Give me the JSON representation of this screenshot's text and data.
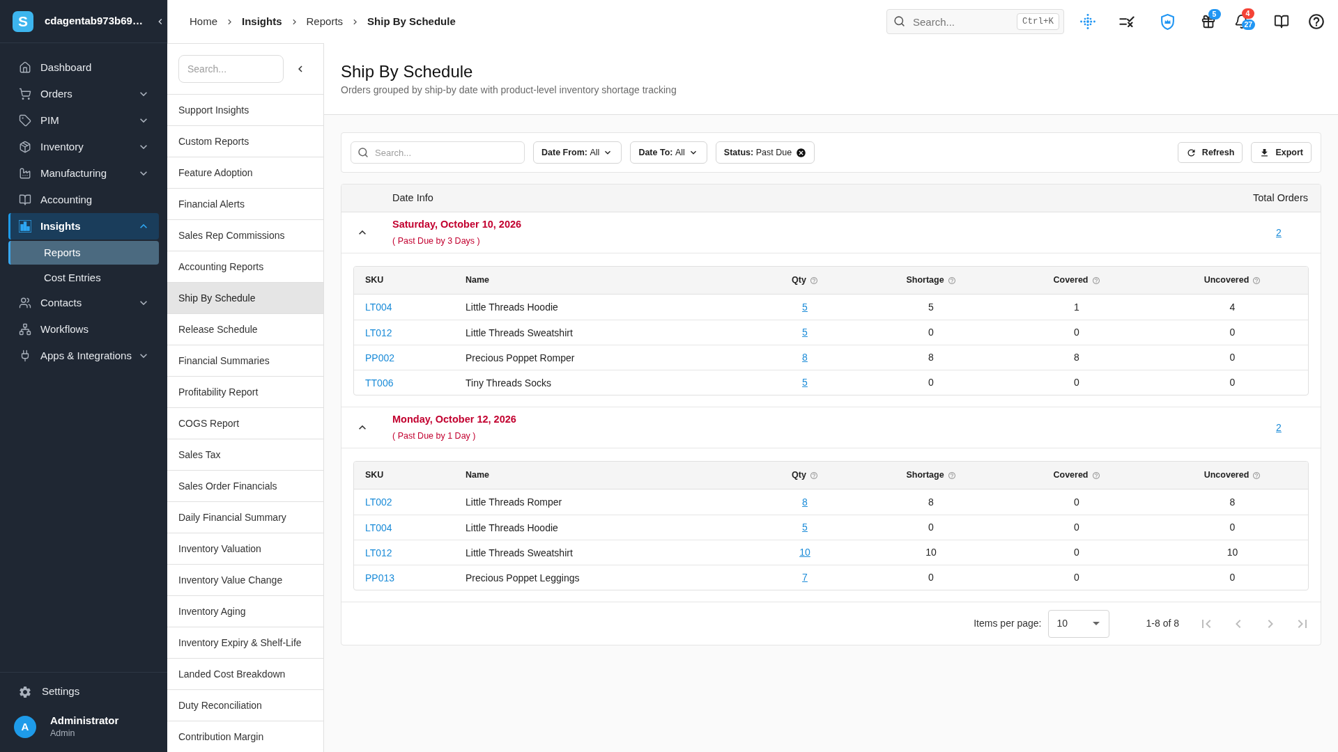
{
  "sidebar": {
    "logo_letter": "S",
    "workspace": "cdagentab973b69…",
    "nav": [
      {
        "label": "Dashboard",
        "kind": "link",
        "selected": false
      },
      {
        "label": "Orders",
        "kind": "group",
        "expanded": false,
        "selected": false
      },
      {
        "label": "PIM",
        "kind": "group",
        "expanded": false,
        "selected": false
      },
      {
        "label": "Inventory",
        "kind": "group",
        "expanded": false,
        "selected": false
      },
      {
        "label": "Manufacturing",
        "kind": "group",
        "expanded": false,
        "selected": false
      },
      {
        "label": "Accounting",
        "kind": "link",
        "selected": false
      },
      {
        "label": "Insights",
        "kind": "group",
        "expanded": true,
        "selected": true,
        "children": [
          {
            "label": "Reports",
            "selected": true
          },
          {
            "label": "Cost Entries",
            "selected": false
          }
        ]
      },
      {
        "label": "Contacts",
        "kind": "group",
        "expanded": false,
        "selected": false
      },
      {
        "label": "Workflows",
        "kind": "link",
        "selected": false
      },
      {
        "label": "Apps & Integrations",
        "kind": "group",
        "expanded": false,
        "selected": false
      }
    ],
    "settings": "Settings",
    "user": {
      "initial": "A",
      "name": "Administrator",
      "role": "Admin"
    }
  },
  "header": {
    "breadcrumb": [
      {
        "label": "Home",
        "strong": false
      },
      {
        "label": "Insights",
        "strong": true
      },
      {
        "label": "Reports",
        "strong": false
      },
      {
        "label": "Ship By Schedule",
        "strong": true
      }
    ],
    "search": {
      "placeholder": "Search...",
      "shortcut": "Ctrl+K"
    },
    "badges": [
      {
        "text": "5",
        "color": "#2196f3"
      },
      {
        "text": "4",
        "color": "#f44336"
      },
      {
        "text": "27",
        "color": "#2196f3"
      }
    ]
  },
  "report_menu": {
    "search": {
      "placeholder": "Search..."
    },
    "items": [
      {
        "label": "Support Insights",
        "selected": false
      },
      {
        "label": "Custom Reports",
        "selected": false
      },
      {
        "label": "Feature Adoption",
        "selected": false
      },
      {
        "label": "Financial Alerts",
        "selected": false
      },
      {
        "label": "Sales Rep Commissions",
        "selected": false
      },
      {
        "label": "Accounting Reports",
        "selected": false
      },
      {
        "label": "Ship By Schedule",
        "selected": true
      },
      {
        "label": "Release Schedule",
        "selected": false
      },
      {
        "label": "Financial Summaries",
        "selected": false
      },
      {
        "label": "Profitability Report",
        "selected": false
      },
      {
        "label": "COGS Report",
        "selected": false
      },
      {
        "label": "Sales Tax",
        "selected": false
      },
      {
        "label": "Sales Order Financials",
        "selected": false
      },
      {
        "label": "Daily Financial Summary",
        "selected": false
      },
      {
        "label": "Inventory Valuation",
        "selected": false
      },
      {
        "label": "Inventory Value Change",
        "selected": false
      },
      {
        "label": "Inventory Aging",
        "selected": false
      },
      {
        "label": "Inventory Expiry & Shelf-Life",
        "selected": false
      },
      {
        "label": "Landed Cost Breakdown",
        "selected": false
      },
      {
        "label": "Duty Reconciliation",
        "selected": false
      },
      {
        "label": "Contribution Margin",
        "selected": false
      }
    ]
  },
  "page": {
    "title": "Ship By Schedule",
    "subtitle": "Orders grouped by ship-by date with product-level inventory shortage tracking"
  },
  "filters": {
    "search": {
      "placeholder": "Search..."
    },
    "chips": [
      {
        "kind": "dropdown",
        "label": "Date From:",
        "value": "All"
      },
      {
        "kind": "dropdown",
        "label": "Date To:",
        "value": "All"
      },
      {
        "kind": "removable",
        "label": "Status:",
        "value": "Past Due"
      }
    ],
    "buttons": [
      {
        "label": "Refresh"
      },
      {
        "label": "Export"
      }
    ]
  },
  "orders_table": {
    "columns": [
      "Date Info",
      "Total Orders"
    ],
    "groups": [
      {
        "date": "Saturday, October 10, 2026",
        "note": "( Past Due by 3 Days )",
        "total": "2",
        "expanded": true,
        "columns": [
          {
            "label": "SKU",
            "info": false
          },
          {
            "label": "Name",
            "info": false
          },
          {
            "label": "Qty",
            "info": true
          },
          {
            "label": "Shortage",
            "info": true
          },
          {
            "label": "Covered",
            "info": true
          },
          {
            "label": "Uncovered",
            "info": true
          }
        ],
        "rows": [
          {
            "sku": "LT004",
            "name": "Little Threads Hoodie",
            "qty": "5",
            "shortage": "5",
            "covered": "1",
            "uncovered": "4"
          },
          {
            "sku": "LT012",
            "name": "Little Threads Sweatshirt",
            "qty": "5",
            "shortage": "0",
            "covered": "0",
            "uncovered": "0"
          },
          {
            "sku": "PP002",
            "name": "Precious Poppet Romper",
            "qty": "8",
            "shortage": "8",
            "covered": "8",
            "uncovered": "0"
          },
          {
            "sku": "TT006",
            "name": "Tiny Threads Socks",
            "qty": "5",
            "shortage": "0",
            "covered": "0",
            "uncovered": "0"
          }
        ]
      },
      {
        "date": "Monday, October 12, 2026",
        "note": "( Past Due by 1 Day )",
        "total": "2",
        "expanded": true,
        "columns": [
          {
            "label": "SKU",
            "info": false
          },
          {
            "label": "Name",
            "info": false
          },
          {
            "label": "Qty",
            "info": true
          },
          {
            "label": "Shortage",
            "info": true
          },
          {
            "label": "Covered",
            "info": true
          },
          {
            "label": "Uncovered",
            "info": true
          }
        ],
        "rows": [
          {
            "sku": "LT002",
            "name": "Little Threads Romper",
            "qty": "8",
            "shortage": "8",
            "covered": "0",
            "uncovered": "8"
          },
          {
            "sku": "LT004",
            "name": "Little Threads Hoodie",
            "qty": "5",
            "shortage": "0",
            "covered": "0",
            "uncovered": "0"
          },
          {
            "sku": "LT012",
            "name": "Little Threads Sweatshirt",
            "qty": "10",
            "shortage": "10",
            "covered": "0",
            "uncovered": "10"
          },
          {
            "sku": "PP013",
            "name": "Precious Poppet Leggings",
            "qty": "7",
            "shortage": "0",
            "covered": "0",
            "uncovered": "0"
          }
        ]
      }
    ]
  },
  "pagination": {
    "label": "Items per page:",
    "page_size": "10",
    "range": "1-8 of 8",
    "nav": [
      {
        "disabled": true
      },
      {
        "disabled": true
      },
      {
        "disabled": true
      },
      {
        "disabled": true
      }
    ]
  }
}
